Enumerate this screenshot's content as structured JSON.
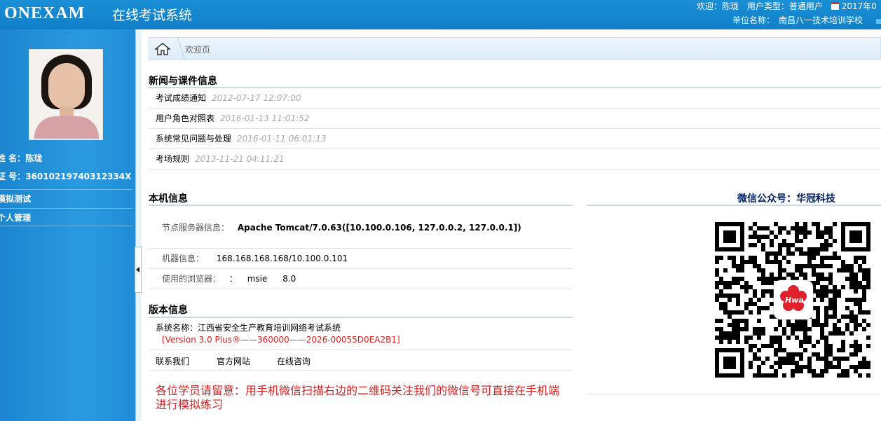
{
  "header": {
    "logo": "ONEXAM",
    "system_name": "在线考试系统",
    "welcome": "欢迎：陈珑",
    "user_type": "用户类型：普通用户",
    "date": "2017年0",
    "org": "单位名称：　南昌八一技术培训学校"
  },
  "profile": {
    "name_label": "姓 名：",
    "name": "陈珑",
    "id_label": "证 号：",
    "id": "36010219740312334X"
  },
  "menu": {
    "items": [
      {
        "label": "模拟测试"
      },
      {
        "label": "个人管理"
      }
    ]
  },
  "breadcrumb": {
    "label": "欢迎页"
  },
  "news": {
    "title": "新闻与课件信息",
    "items": [
      {
        "title": "考试成绩通知",
        "date": "2012-07-17 12:07:00"
      },
      {
        "title": "用户角色对照表",
        "date": "2016-01-13 11:01:52"
      },
      {
        "title": "系统常见问题与处理",
        "date": "2016-01-11 06:01:13"
      },
      {
        "title": "考场规则",
        "date": "2013-11-21 04:11:21"
      }
    ]
  },
  "machine": {
    "title": "本机信息",
    "server_label": "节点服务器信息：",
    "server_value": "Apache Tomcat/7.0.63([10.100.0.106, 127.0.0.2, 127.0.0.1])",
    "machine_label": "机器信息：",
    "machine_value": "168.168.168.168/10.100.0.101",
    "browser_label": "使用的浏览器：",
    "browser_colon": "：",
    "browser_name": "msie",
    "browser_version": "8.0"
  },
  "version": {
    "title": "版本信息",
    "system_name": "系统名称：江西省安全生产教育培训网络考试系统",
    "version_string": "[Version 3.0 Plus®——360000——2026-00055D0EA2B1]",
    "links": [
      "联系我们",
      "官方网站",
      "在线咨询"
    ]
  },
  "notice": "各位学员请留意：用手机微信扫描右边的二维码关注我们的微信号可直接在手机端进行模拟练习",
  "wechat": {
    "title": "微信公众号：华冠科技",
    "logo_text": "Hwa"
  },
  "colors": {
    "header_blue": "#1a8fd6",
    "sidebar_blue": "#2a9ae0",
    "notice_red": "#d81e1e"
  }
}
